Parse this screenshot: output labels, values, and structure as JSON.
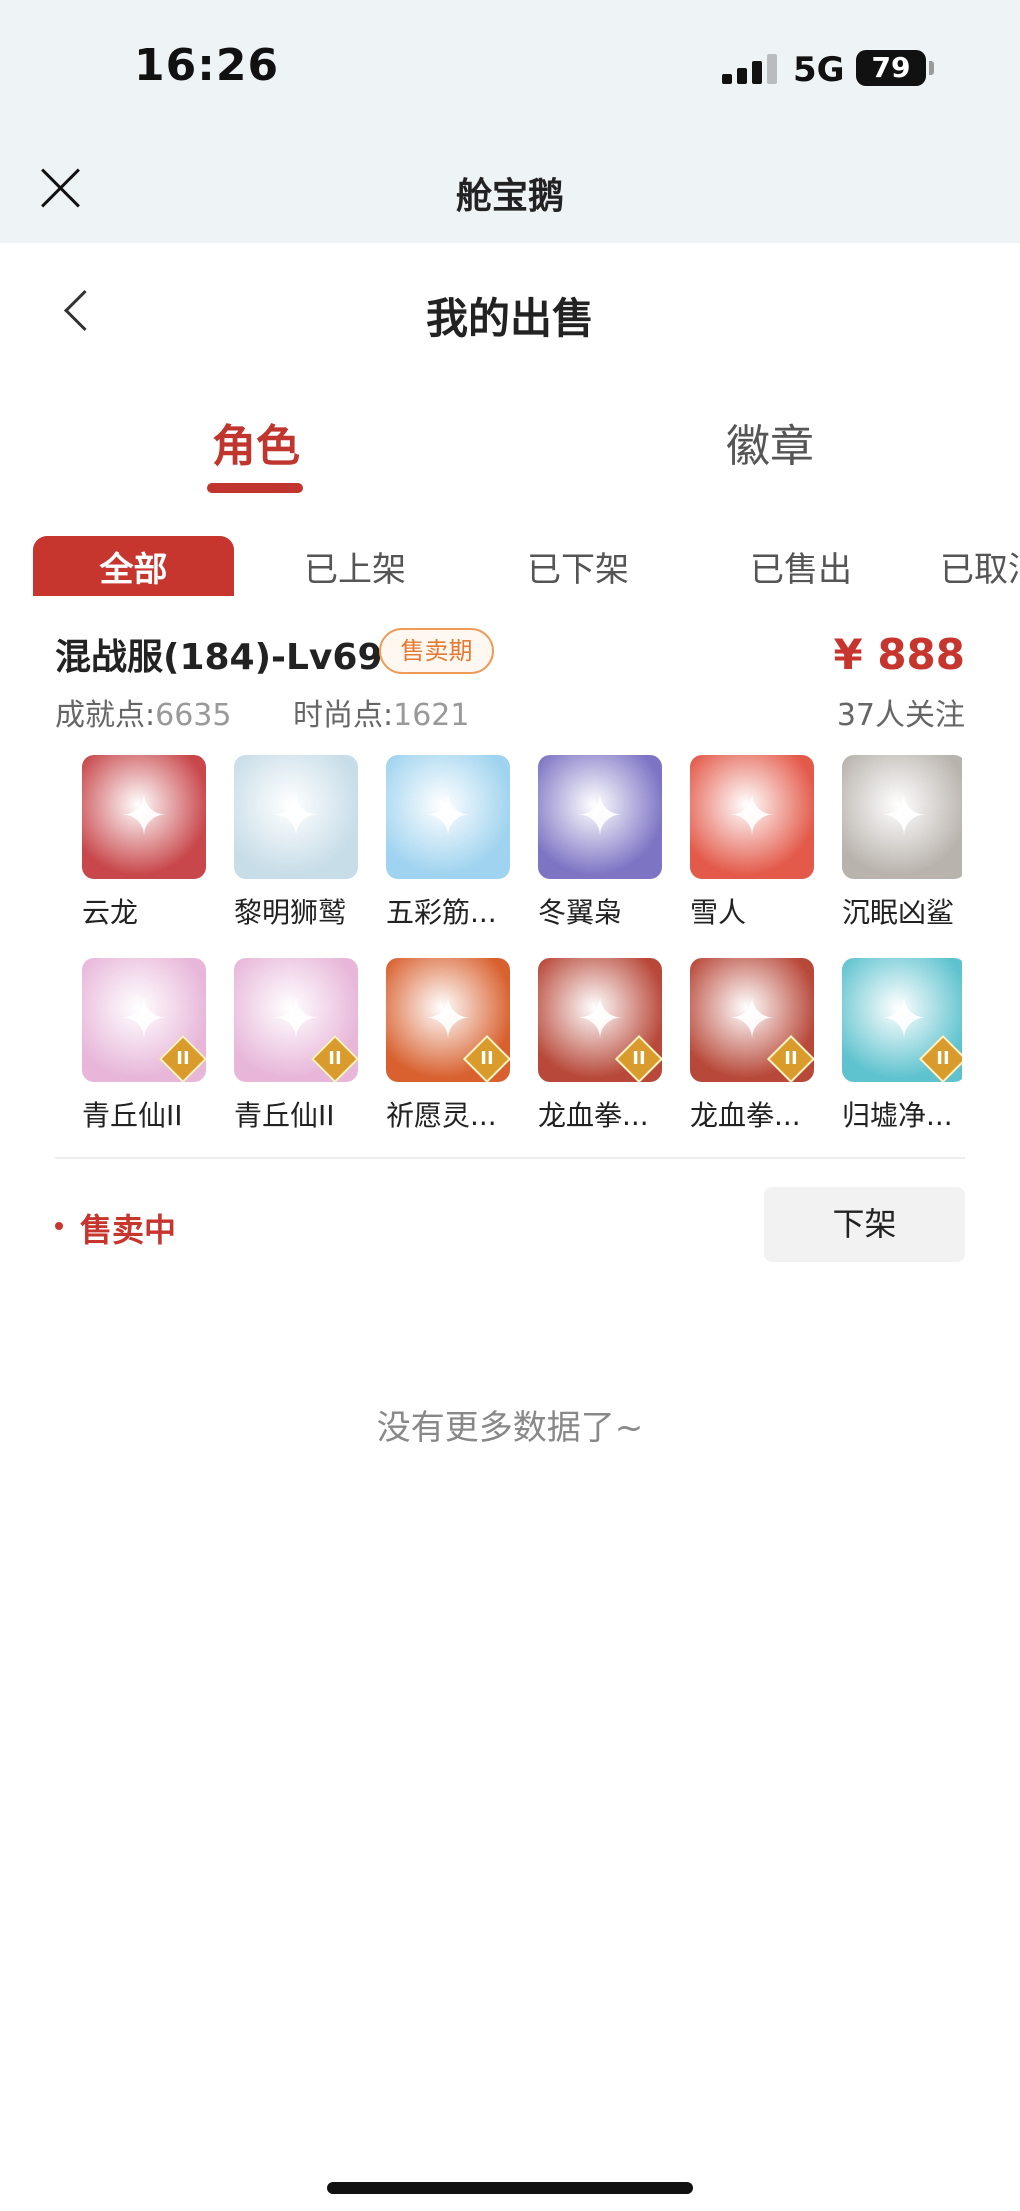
{
  "status_bar": {
    "time": "16:26",
    "network": "5G",
    "battery": "79"
  },
  "webview": {
    "title": "舱宝鹅"
  },
  "page": {
    "title": "我的出售"
  },
  "tabs": [
    {
      "label": "角色",
      "active": true
    },
    {
      "label": "徽章",
      "active": false
    }
  ],
  "filters": [
    {
      "label": "全部",
      "active": true
    },
    {
      "label": "已上架"
    },
    {
      "label": "已下架"
    },
    {
      "label": "已售出"
    },
    {
      "label": "已取消"
    }
  ],
  "listing": {
    "title": "混战服(184)-Lv69",
    "status_pill": "售卖期",
    "price": "¥ 888",
    "achievement_label": "成就点:",
    "achievement_value": "6635",
    "fashion_label": "时尚点:",
    "fashion_value": "1621",
    "watchers": "37人关注",
    "items": [
      {
        "name": "云龙",
        "color": "#c8474b",
        "icon": "dragon-icon",
        "rank": ""
      },
      {
        "name": "黎明狮鹫",
        "color": "#c7dde8",
        "icon": "griffin-icon",
        "rank": ""
      },
      {
        "name": "五彩筋...",
        "color": "#9fd3ef",
        "icon": "cloud-icon",
        "rank": ""
      },
      {
        "name": "冬翼枭",
        "color": "#7d74c4",
        "icon": "owl-icon",
        "rank": ""
      },
      {
        "name": "雪人",
        "color": "#e35a4a",
        "icon": "snowman-icon",
        "rank": ""
      },
      {
        "name": "沉眠凶鲨",
        "color": "#b9b3ad",
        "icon": "shark-icon",
        "rank": ""
      },
      {
        "name": "青丘仙II",
        "color": "#e7b6d9",
        "icon": "fox-fairy-icon",
        "rank": "II"
      },
      {
        "name": "青丘仙II",
        "color": "#e7b6d9",
        "icon": "fox-fairy-icon",
        "rank": "II"
      },
      {
        "name": "祈愿灵...",
        "color": "#d8612f",
        "icon": "spirit-bird-icon",
        "rank": "II"
      },
      {
        "name": "龙血拳...",
        "color": "#b8493a",
        "icon": "boxer-icon",
        "rank": "II"
      },
      {
        "name": "龙血拳...",
        "color": "#b8493a",
        "icon": "boxer-icon",
        "rank": "II"
      },
      {
        "name": "归墟净...",
        "color": "#5fc3cf",
        "icon": "water-dragon-icon",
        "rank": "II"
      }
    ],
    "selling_status": "售卖中",
    "delist_button": "下架"
  },
  "footer": {
    "no_more": "没有更多数据了~"
  }
}
